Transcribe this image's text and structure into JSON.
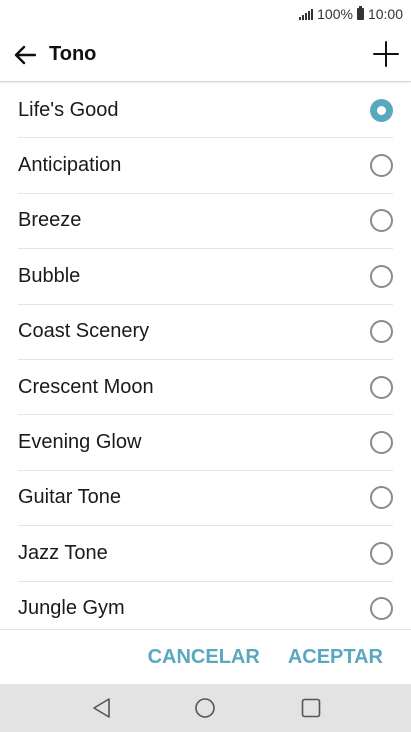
{
  "status_bar": {
    "battery_percent": "100%",
    "time": "10:00",
    "icons": [
      "signal-icon",
      "battery-icon"
    ]
  },
  "app_bar": {
    "title": "Tono",
    "back_icon": "arrow-left-icon",
    "add_icon": "plus-icon"
  },
  "ringtones": {
    "selected_index": 0,
    "items": [
      {
        "label": "Life's Good",
        "selected": true
      },
      {
        "label": "Anticipation",
        "selected": false
      },
      {
        "label": "Breeze",
        "selected": false
      },
      {
        "label": "Bubble",
        "selected": false
      },
      {
        "label": "Coast Scenery",
        "selected": false
      },
      {
        "label": "Crescent Moon",
        "selected": false
      },
      {
        "label": "Evening Glow",
        "selected": false
      },
      {
        "label": "Guitar Tone",
        "selected": false
      },
      {
        "label": "Jazz Tone",
        "selected": false
      },
      {
        "label": "Jungle Gym",
        "selected": false
      }
    ]
  },
  "actions": {
    "cancel_label": "CANCELAR",
    "accept_label": "ACEPTAR"
  },
  "nav_bar": {
    "icons": [
      "nav-back-icon",
      "nav-home-icon",
      "nav-recent-icon"
    ]
  },
  "colors": {
    "accent": "#5aa8be",
    "nav_background": "#e3e3e3",
    "divider": "#e3e3e3"
  }
}
